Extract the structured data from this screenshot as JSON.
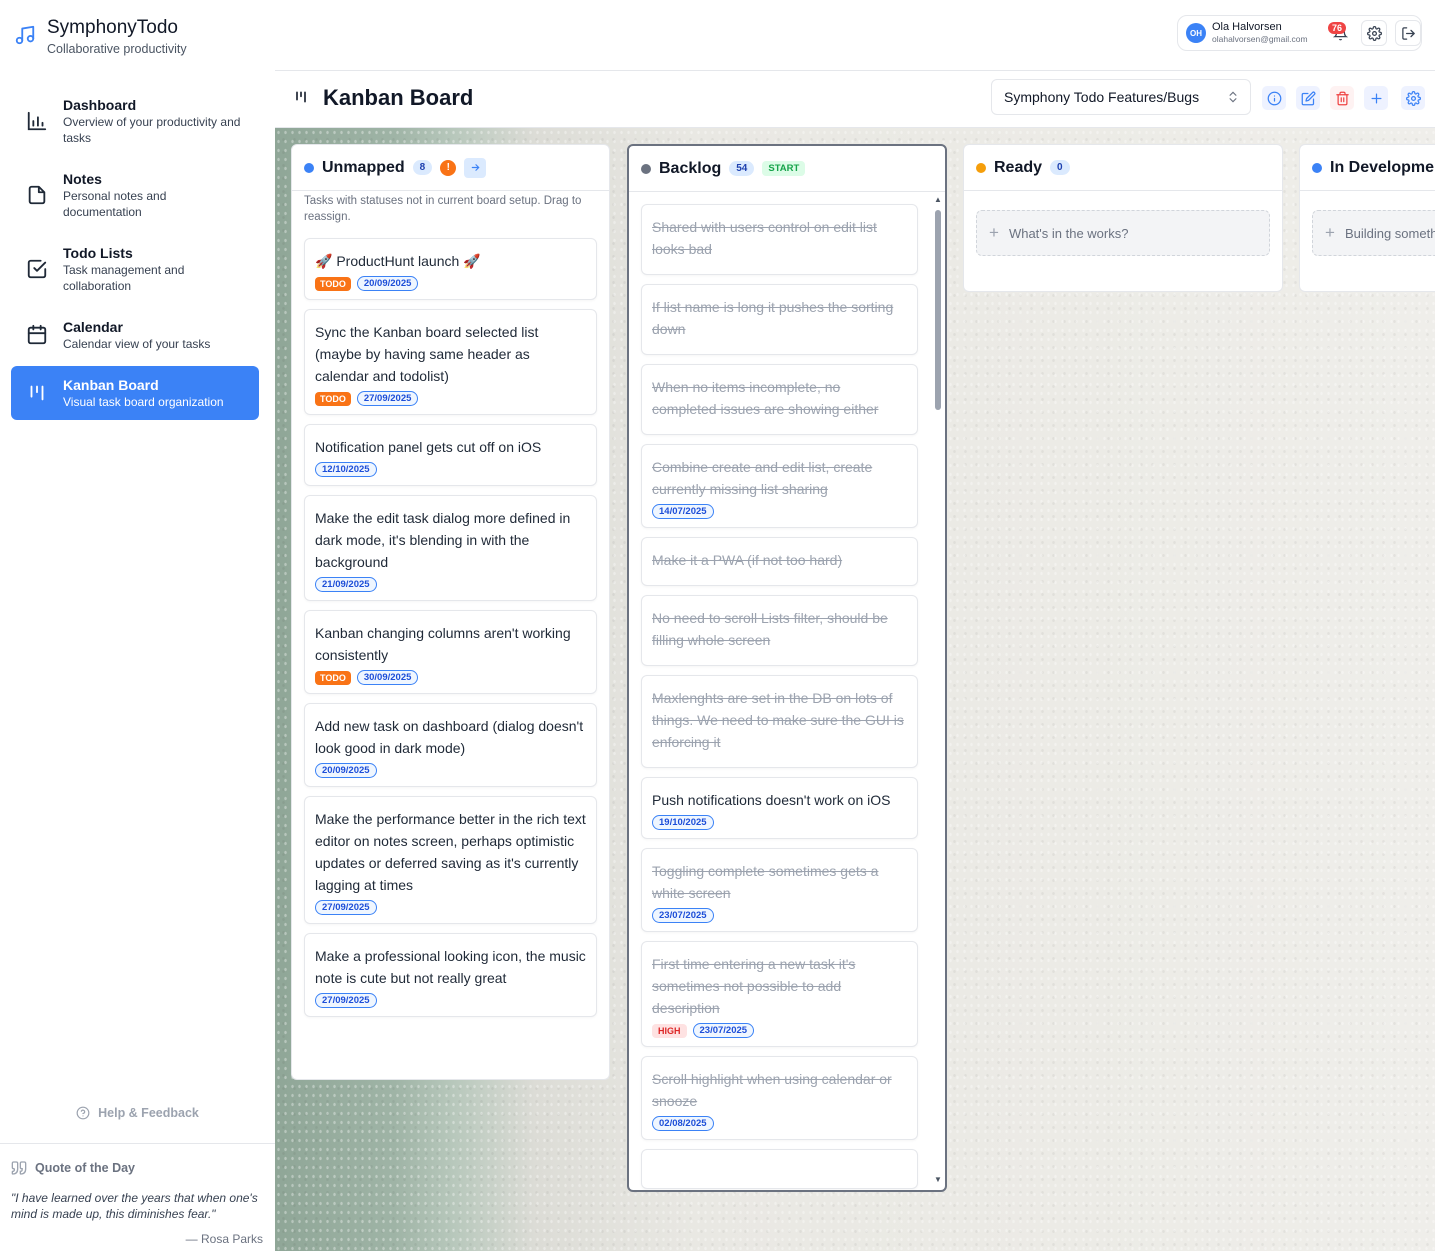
{
  "app": {
    "name": "SymphonyTodo",
    "tagline": "Collaborative productivity",
    "accent": "#3b82f6"
  },
  "nav": [
    {
      "title": "Dashboard",
      "subtitle": "Overview of your productivity and tasks",
      "icon": "bar-chart-icon"
    },
    {
      "title": "Notes",
      "subtitle": "Personal notes and documentation",
      "icon": "file-icon"
    },
    {
      "title": "Todo Lists",
      "subtitle": "Task management and collaboration",
      "icon": "check-square-icon"
    },
    {
      "title": "Calendar",
      "subtitle": "Calendar view of your tasks",
      "icon": "calendar-icon"
    },
    {
      "title": "Kanban Board",
      "subtitle": "Visual task board organization",
      "icon": "kanban-icon",
      "active": true
    }
  ],
  "help_label": "Help & Feedback",
  "quote": {
    "heading": "Quote of the Day",
    "text": "\"I have learned over the years that when one's mind is made up, this diminishes fear.\"",
    "author": "— Rosa Parks"
  },
  "user": {
    "initials": "OH",
    "name": "Ola Halvorsen",
    "email": "olahalvorsen@gmail.com",
    "notifications": "76"
  },
  "header": {
    "title": "Kanban Board",
    "selected_list": "Symphony Todo Features/Bugs"
  },
  "columns": {
    "unmapped": {
      "title": "Unmapped",
      "count": "8",
      "warn": "!",
      "dot_color": "#3b82f6",
      "note": "Tasks with statuses not in current board setup. Drag to reassign.",
      "cards": [
        {
          "title": "🚀 ProductHunt launch 🚀",
          "status": "TODO",
          "date": "20/09/2025"
        },
        {
          "title": "Sync the Kanban board selected list (maybe by having same header as calendar and todolist)",
          "status": "TODO",
          "date": "27/09/2025"
        },
        {
          "title": "Notification panel gets cut off on iOS",
          "date": "12/10/2025"
        },
        {
          "title": "Make the edit task dialog more defined in dark mode, it's blending in with the background",
          "date": "21/09/2025"
        },
        {
          "title": "Kanban changing columns aren't working consistently",
          "status": "TODO",
          "date": "30/09/2025"
        },
        {
          "title": "Add new task on dashboard (dialog doesn't look good in dark mode)",
          "date": "20/09/2025"
        },
        {
          "title": "Make the performance better in the rich text editor on notes screen, perhaps optimistic updates or deferred saving as it's currently lagging at times",
          "date": "27/09/2025"
        },
        {
          "title": "Make a professional looking icon, the music note is cute but not really great",
          "date": "27/09/2025"
        }
      ]
    },
    "backlog": {
      "title": "Backlog",
      "count": "54",
      "tag": "START",
      "dot_color": "#6b7280",
      "cards": [
        {
          "title": "Shared with users control on edit list looks bad",
          "done": true
        },
        {
          "title": "If list name is long it pushes the sorting down",
          "done": true
        },
        {
          "title": "When no items incomplete, no completed issues are showing either",
          "done": true
        },
        {
          "title": "Combine create and edit list, create currently missing list sharing",
          "done": true,
          "date": "14/07/2025"
        },
        {
          "title": "Make it a PWA (if not too hard)",
          "done": true
        },
        {
          "title": "No need to scroll Lists filter, should be filling whole screen",
          "done": true
        },
        {
          "title": "Maxlenghts are set in the DB on lots of things. We need to make sure the GUI is enforcing it",
          "done": true
        },
        {
          "title": "Push notifications doesn't work on iOS",
          "date": "19/10/2025"
        },
        {
          "title": "Toggling complete sometimes gets a white screen",
          "done": true,
          "date": "23/07/2025"
        },
        {
          "title": "First time entering a new task it's sometimes not possible to add description",
          "done": true,
          "priority": "HIGH",
          "date": "23/07/2025"
        },
        {
          "title": "Scroll highlight when using calendar or snooze",
          "done": true,
          "date": "02/08/2025"
        }
      ]
    },
    "ready": {
      "title": "Ready",
      "count": "0",
      "dot_color": "#f59e0b",
      "add_placeholder": "What's in the works?"
    },
    "in_development": {
      "title": "In Development",
      "dot_color": "#3b82f6",
      "add_placeholder": "Building something?"
    }
  }
}
